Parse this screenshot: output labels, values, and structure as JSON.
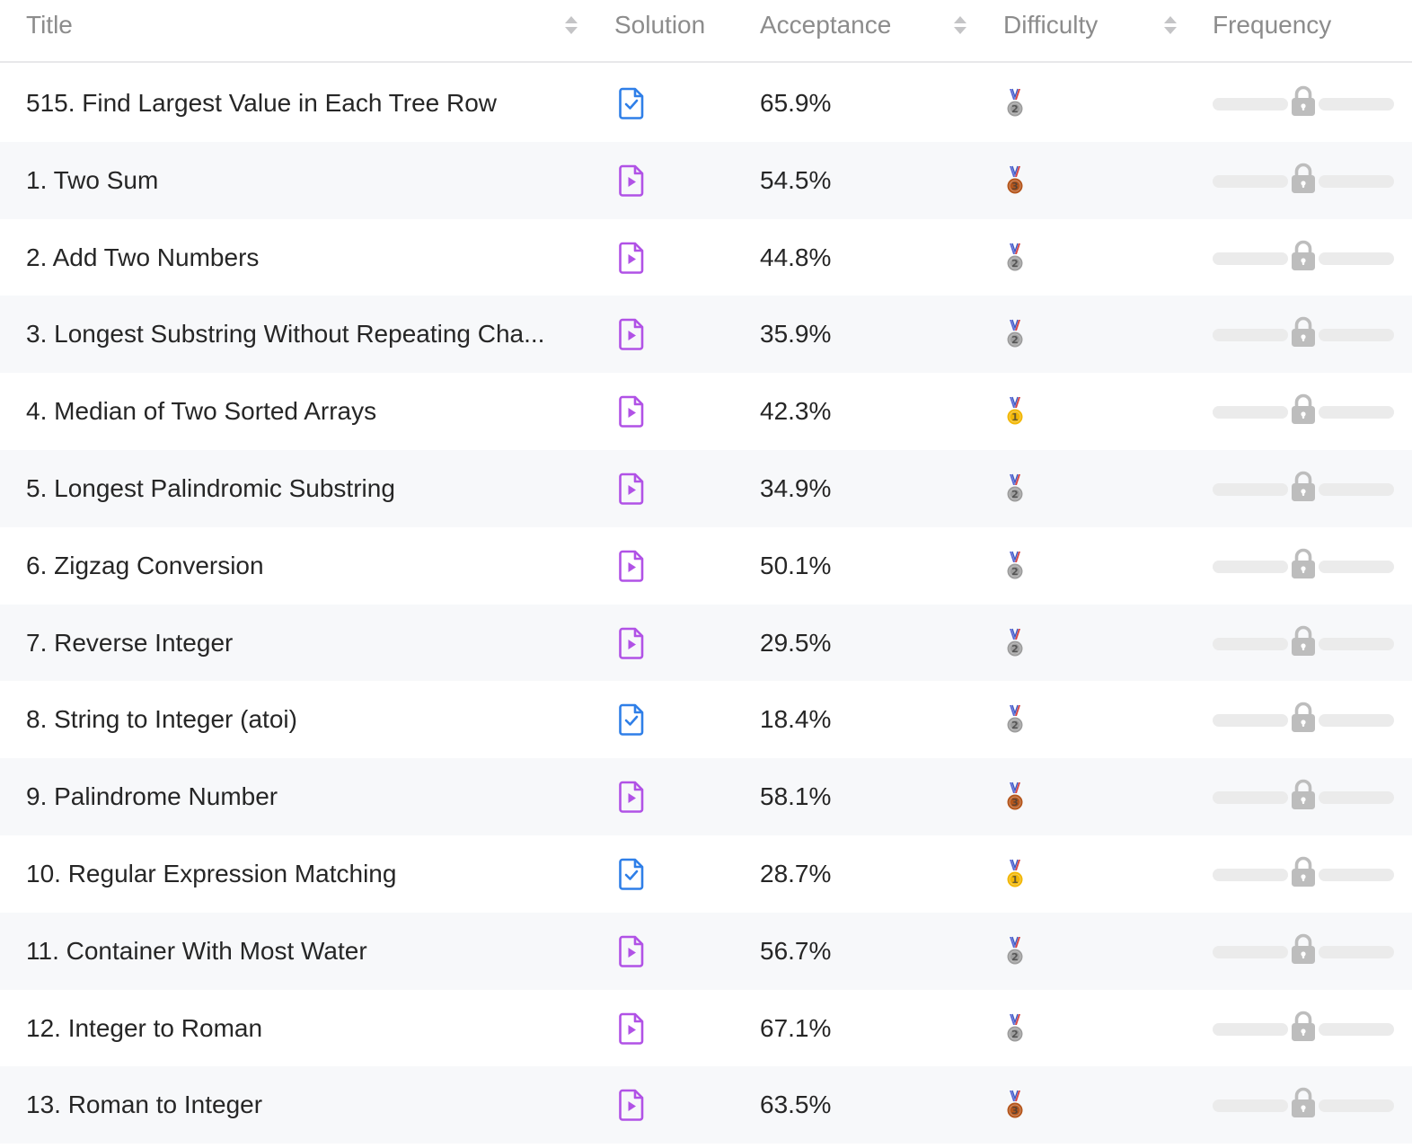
{
  "header": {
    "title_label": "Title",
    "solution_label": "Solution",
    "acceptance_label": "Acceptance",
    "difficulty_label": "Difficulty",
    "frequency_label": "Frequency"
  },
  "colors": {
    "solution_article": "#2f7fe8",
    "solution_video": "#b152e6",
    "medal_gold": "#f2b705",
    "medal_silver": "#9e9e9e",
    "medal_bronze": "#b5561c",
    "row_alt_bg": "#f7f8fa",
    "lock_gray": "#bdbdbd"
  },
  "rows": [
    {
      "title": "515. Find Largest Value in Each Tree Row",
      "solution": "article-check-icon",
      "acceptance": "65.9%",
      "difficulty_medal": "2"
    },
    {
      "title": "1. Two Sum",
      "solution": "video-play-icon",
      "acceptance": "54.5%",
      "difficulty_medal": "3"
    },
    {
      "title": "2. Add Two Numbers",
      "solution": "video-play-icon",
      "acceptance": "44.8%",
      "difficulty_medal": "2"
    },
    {
      "title": "3. Longest Substring Without Repeating Cha...",
      "solution": "video-play-icon",
      "acceptance": "35.9%",
      "difficulty_medal": "2"
    },
    {
      "title": "4. Median of Two Sorted Arrays",
      "solution": "video-play-icon",
      "acceptance": "42.3%",
      "difficulty_medal": "1"
    },
    {
      "title": "5. Longest Palindromic Substring",
      "solution": "video-play-icon",
      "acceptance": "34.9%",
      "difficulty_medal": "2"
    },
    {
      "title": "6. Zigzag Conversion",
      "solution": "video-play-icon",
      "acceptance": "50.1%",
      "difficulty_medal": "2"
    },
    {
      "title": "7. Reverse Integer",
      "solution": "video-play-icon",
      "acceptance": "29.5%",
      "difficulty_medal": "2"
    },
    {
      "title": "8. String to Integer (atoi)",
      "solution": "article-check-icon",
      "acceptance": "18.4%",
      "difficulty_medal": "2"
    },
    {
      "title": "9. Palindrome Number",
      "solution": "video-play-icon",
      "acceptance": "58.1%",
      "difficulty_medal": "3"
    },
    {
      "title": "10. Regular Expression Matching",
      "solution": "article-check-icon",
      "acceptance": "28.7%",
      "difficulty_medal": "1"
    },
    {
      "title": "11. Container With Most Water",
      "solution": "video-play-icon",
      "acceptance": "56.7%",
      "difficulty_medal": "2"
    },
    {
      "title": "12. Integer to Roman",
      "solution": "video-play-icon",
      "acceptance": "67.1%",
      "difficulty_medal": "2"
    },
    {
      "title": "13. Roman to Integer",
      "solution": "video-play-icon",
      "acceptance": "63.5%",
      "difficulty_medal": "3"
    }
  ]
}
